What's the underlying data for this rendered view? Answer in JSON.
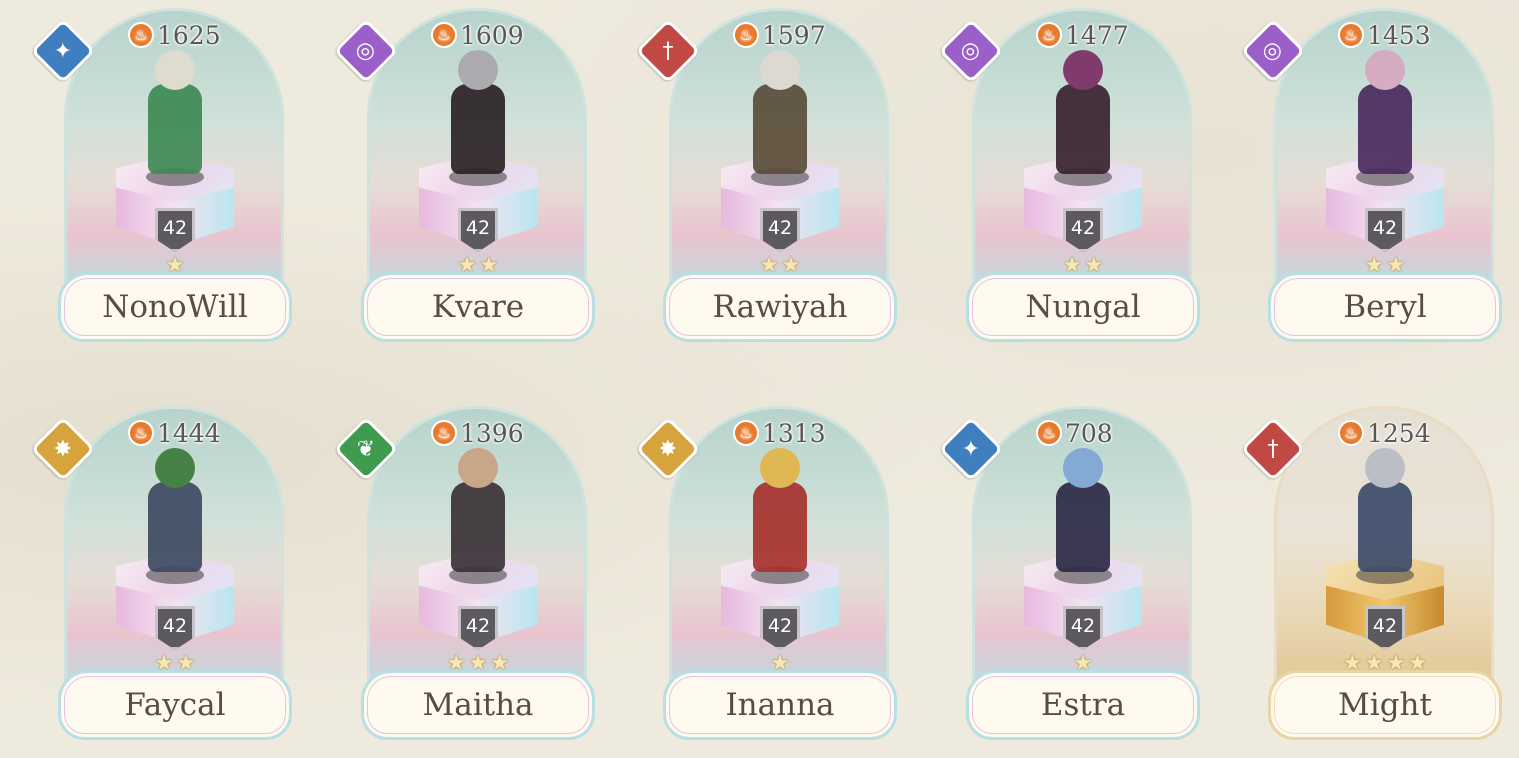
{
  "roster": [
    {
      "name": "NonoWill",
      "power": "1625",
      "level": "42",
      "stars": "★",
      "element_icon": "blue-shuriken-icon",
      "element_class": "el-blue",
      "glyph": "✦",
      "sprite_colors": [
        "#e2dccf",
        "#3f8a55"
      ],
      "variant": "normal"
    },
    {
      "name": "Kvare",
      "power": "1609",
      "level": "42",
      "stars": "★★",
      "element_icon": "purple-swirl-icon",
      "element_class": "el-purple",
      "glyph": "◎",
      "sprite_colors": [
        "#a9a7ad",
        "#2b2326"
      ],
      "variant": "normal"
    },
    {
      "name": "Rawiyah",
      "power": "1597",
      "level": "42",
      "stars": "★★",
      "element_icon": "red-sword-icon",
      "element_class": "el-red",
      "glyph": "†",
      "sprite_colors": [
        "#ded9d2",
        "#5b4d3a"
      ],
      "variant": "normal"
    },
    {
      "name": "Nungal",
      "power": "1477",
      "level": "42",
      "stars": "★★",
      "element_icon": "purple-swirl-icon",
      "element_class": "el-purple",
      "glyph": "◎",
      "sprite_colors": [
        "#7b2d63",
        "#3a2330"
      ],
      "variant": "normal"
    },
    {
      "name": "Beryl",
      "power": "1453",
      "level": "42",
      "stars": "★★",
      "element_icon": "purple-swirl-icon",
      "element_class": "el-purple",
      "glyph": "◎",
      "sprite_colors": [
        "#d7a8c1",
        "#4a2a5e"
      ],
      "variant": "normal"
    },
    {
      "name": "Faycal",
      "power": "1444",
      "level": "42",
      "stars": "★★",
      "element_icon": "gold-compass-icon",
      "element_class": "el-gold",
      "glyph": "✸",
      "sprite_colors": [
        "#3c7a3a",
        "#3e4a63"
      ],
      "variant": "normal"
    },
    {
      "name": "Maitha",
      "power": "1396",
      "level": "42",
      "stars": "★★★",
      "element_icon": "green-leaf-icon",
      "element_class": "el-green",
      "glyph": "❦",
      "sprite_colors": [
        "#c9a382",
        "#3b3338"
      ],
      "variant": "normal"
    },
    {
      "name": "Inanna",
      "power": "1313",
      "level": "42",
      "stars": "★",
      "element_icon": "gold-compass-icon",
      "element_class": "el-gold",
      "glyph": "✸",
      "sprite_colors": [
        "#e2b64a",
        "#a7322e"
      ],
      "variant": "normal"
    },
    {
      "name": "Estra",
      "power": "708",
      "level": "42",
      "stars": "★",
      "element_icon": "blue-shuriken-icon",
      "element_class": "el-blue",
      "glyph": "✦",
      "sprite_colors": [
        "#7ea6d6",
        "#2d2a45"
      ],
      "variant": "normal"
    },
    {
      "name": "Might",
      "power": "1254",
      "level": "42",
      "stars": "★★★★",
      "element_icon": "red-sword-icon",
      "element_class": "el-red",
      "glyph": "†",
      "sprite_colors": [
        "#b8bcc4",
        "#3d4c6b"
      ],
      "variant": "gold"
    }
  ]
}
